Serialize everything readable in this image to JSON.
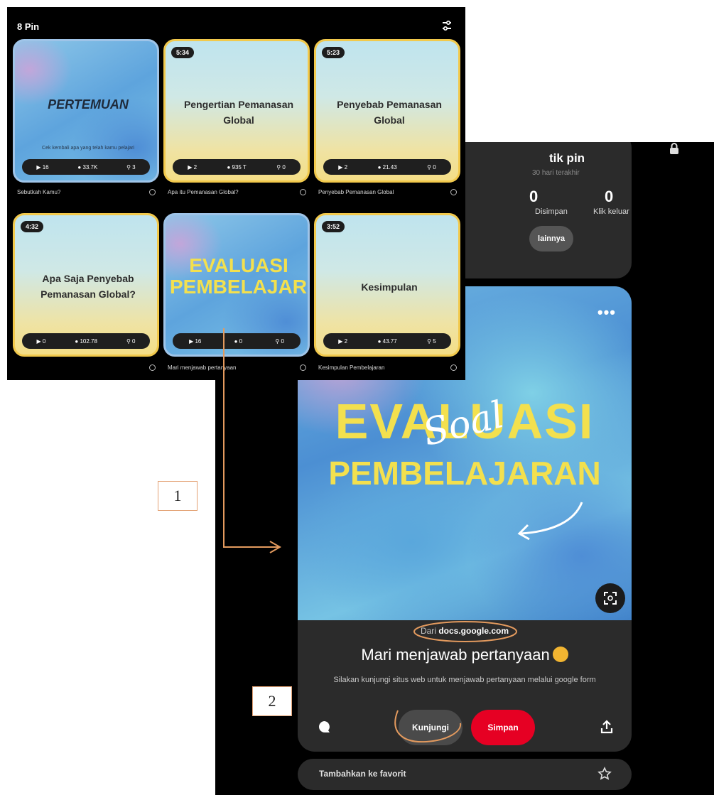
{
  "grid": {
    "header": "8 Pin",
    "tiles": [
      {
        "duration": "",
        "title": "PERTEMUAN",
        "subtitle": "Cek kembali apa yang telah kamu pelajari",
        "stats": [
          "16",
          "33.7K",
          "3"
        ],
        "caption": "Sebutkah Kamu?"
      },
      {
        "duration": "5:34",
        "title": "Pengertian Pemanasan Global",
        "stats": [
          "2",
          "935 T",
          "0"
        ],
        "caption": "Apa itu Pemanasan Global?"
      },
      {
        "duration": "5:23",
        "title": "Penyebab Pemanasan Global",
        "stats": [
          "2",
          "21.43",
          "0"
        ],
        "caption": "Penyebab Pemanasan Global"
      },
      {
        "duration": "4:32",
        "title": "Apa Saja Penyebab Pemanasan Global?",
        "stats": [
          "0",
          "102.78",
          "0"
        ],
        "caption": ""
      },
      {
        "duration": "",
        "title": "EVALUASI PEMBELAJARAN",
        "stats": [
          "16",
          "0",
          "0"
        ],
        "caption": "Mari menjawab pertanyaan"
      },
      {
        "duration": "3:52",
        "title": "Kesimpulan",
        "stats": [
          "2",
          "43.77",
          "5"
        ],
        "caption": "Kesimpulan Pembelajaran"
      }
    ]
  },
  "detail": {
    "stats_title": "tik pin",
    "stats_subtitle": "30 hari terakhir",
    "stat1_value": "0",
    "stat1_label": "Disimpan",
    "stat2_value": "0",
    "stat2_label": "Klik keluar",
    "more_label": "lainnya",
    "pin_big_title_1": "EVALUASI",
    "pin_big_title_2": "PEMBELAJARAN",
    "pin_script": "Soal",
    "source_prefix": "Dari",
    "source_domain": "docs.google.com",
    "pin_title": "Mari menjawab pertanyaan",
    "pin_description": "Silakan kunjungi situs web untuk menjawab pertanyaan melalui google form",
    "visit_label": "Kunjungi",
    "save_label": "Simpan",
    "favorite_label": "Tambahkan ke favorit"
  },
  "annotations": {
    "box1": "1",
    "box2": "2",
    "color": "#e39a5e"
  },
  "colors": {
    "save": "#e60023",
    "accent_yellow": "#f3e04e"
  }
}
